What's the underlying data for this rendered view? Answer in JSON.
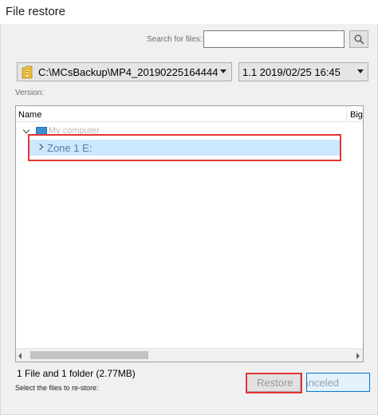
{
  "window": {
    "title": "File restore"
  },
  "search": {
    "label": "Search for files:",
    "value": "",
    "placeholder": ""
  },
  "backup": {
    "path": "C:\\MCsBackup\\MP4_20190225164444",
    "version": "1.1  2019/02/25 16:45"
  },
  "version_label": "Version:",
  "tree": {
    "columns": {
      "name": "Name",
      "size": "Big"
    },
    "root_label": "My computer",
    "zone_label": "Zone 1 E:"
  },
  "footer": {
    "summary": "1 File and 1 folder (2.77MB)",
    "hint": "Select the files to re-store:",
    "restore_label": "Restore",
    "cancel_label": "canceled"
  },
  "colors": {
    "highlight": "#e33434",
    "selection": "#cce8ff",
    "accent": "#0078d7"
  },
  "icons": {
    "search": "magnifier-icon",
    "folder": "folder-zip-icon",
    "computer": "monitor-icon"
  }
}
